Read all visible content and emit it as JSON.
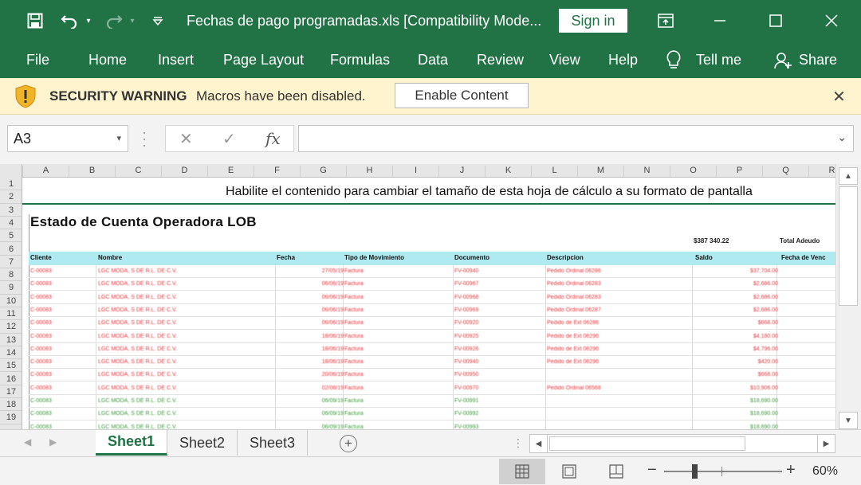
{
  "titlebar": {
    "title": "Fechas de pago programadas.xls  [Compatibility Mode...",
    "sign_in": "Sign in"
  },
  "ribbon": {
    "tabs": [
      "File",
      "Home",
      "Insert",
      "Page Layout",
      "Formulas",
      "Data",
      "Review",
      "View",
      "Help",
      "Tell me",
      "Share"
    ]
  },
  "security": {
    "warning": "SECURITY WARNING",
    "message": "Macros have been disabled.",
    "button": "Enable Content"
  },
  "formula_bar": {
    "name_box": "A3",
    "fx": "fx",
    "value": ""
  },
  "grid": {
    "columns": [
      "A",
      "B",
      "C",
      "D",
      "E",
      "F",
      "G",
      "H",
      "I",
      "J",
      "K",
      "L",
      "M",
      "N",
      "O",
      "P",
      "Q",
      "R"
    ],
    "rows": [
      "1",
      "2",
      "3",
      "4",
      "5",
      "6",
      "7",
      "8",
      "9",
      "10",
      "11",
      "12",
      "13",
      "14",
      "15",
      "16",
      "17",
      "18",
      "19"
    ]
  },
  "sheet": {
    "notice": "Habilite el contenido para cambiar el tamaño de esta hoja de cálculo a su formato de pantalla",
    "report_title": "Estado de Cuenta Operadora LOB",
    "saldo_top": "$387 340.22",
    "total_top": "Total Adeudo",
    "headers": [
      "Cliente",
      "Nombre",
      "Fecha",
      "Tipo de Movimiento",
      "Documento",
      "Descripcion",
      "Saldo",
      "Fecha de Venc"
    ],
    "rows": [
      {
        "cliente": "C-00083",
        "nombre": "LGC MODA, S DE R.L. DE C.V.",
        "fecha": "27/05/19",
        "tipo": "Factura",
        "doc": "FV-00940",
        "desc": "Pedido Ordinal 06286",
        "saldo": "$37,704.00",
        "color": "#e8343a"
      },
      {
        "cliente": "C-00083",
        "nombre": "LGC MODA, S DE R.L. DE C.V.",
        "fecha": "06/06/19",
        "tipo": "Factura",
        "doc": "FV-00967",
        "desc": "Pedido Ordinal 06283",
        "saldo": "$2,686.00",
        "color": "#e8343a"
      },
      {
        "cliente": "C-00083",
        "nombre": "LGC MODA, S DE R.L. DE C.V.",
        "fecha": "06/06/19",
        "tipo": "Factura",
        "doc": "FV-00968",
        "desc": "Pedido Ordinal 06283",
        "saldo": "$2,686.00",
        "color": "#e8343a"
      },
      {
        "cliente": "C-00083",
        "nombre": "LGC MODA, S DE R.L. DE C.V.",
        "fecha": "06/06/19",
        "tipo": "Factura",
        "doc": "FV-00969",
        "desc": "Pedido Ordinal 06287",
        "saldo": "$2,686.00",
        "color": "#e8343a"
      },
      {
        "cliente": "C-00083",
        "nombre": "LGC MODA, S DE R.L. DE C.V.",
        "fecha": "06/06/19",
        "tipo": "Factura",
        "doc": "FV-00920",
        "desc": "Pedido de Ext 06286",
        "saldo": "$668.00",
        "color": "#e8343a"
      },
      {
        "cliente": "C-00083",
        "nombre": "LGC MODA, S DE R.L. DE C.V.",
        "fecha": "18/06/19",
        "tipo": "Factura",
        "doc": "FV-00925",
        "desc": "Pedido de Ext 06296",
        "saldo": "$4,180.00",
        "color": "#e8343a"
      },
      {
        "cliente": "C-00083",
        "nombre": "LGC MODA, S DE R.L. DE C.V.",
        "fecha": "18/06/19",
        "tipo": "Factura",
        "doc": "FV-00926",
        "desc": "Pedido de Ext 06296",
        "saldo": "$4,796.00",
        "color": "#e8343a"
      },
      {
        "cliente": "C-00083",
        "nombre": "LGC MODA, S DE R.L. DE C.V.",
        "fecha": "18/06/19",
        "tipo": "Factura",
        "doc": "FV-00940",
        "desc": "Pedido de Ext 06296",
        "saldo": "$420.00",
        "color": "#e8343a"
      },
      {
        "cliente": "C-00083",
        "nombre": "LGC MODA, S DE R.L. DE C.V.",
        "fecha": "20/06/19",
        "tipo": "Factura",
        "doc": "FV-00950",
        "desc": "",
        "saldo": "$668.00",
        "color": "#e8343a"
      },
      {
        "cliente": "C-00083",
        "nombre": "LGC MODA, S DE R.L. DE C.V.",
        "fecha": "02/08/19",
        "tipo": "Factura",
        "doc": "FV-00970",
        "desc": "Pedido Ordinal 06568",
        "saldo": "$10,906.00",
        "color": "#e8343a"
      },
      {
        "cliente": "C-00083",
        "nombre": "LGC MODA, S DE R.L. DE C.V.",
        "fecha": "06/09/19",
        "tipo": "Factura",
        "doc": "FV-00991",
        "desc": "",
        "saldo": "$18,690.00",
        "color": "#3a9a3a"
      },
      {
        "cliente": "C-00083",
        "nombre": "LGC MODA, S DE R.L. DE C.V.",
        "fecha": "06/09/19",
        "tipo": "Factura",
        "doc": "FV-00992",
        "desc": "",
        "saldo": "$18,690.00",
        "color": "#3a9a3a"
      },
      {
        "cliente": "C-00083",
        "nombre": "LGC MODA, S DE R.L. DE C.V.",
        "fecha": "06/09/19",
        "tipo": "Factura",
        "doc": "FV-00993",
        "desc": "",
        "saldo": "$18,690.00",
        "color": "#3a9a3a"
      }
    ]
  },
  "sheet_tabs": [
    "Sheet1",
    "Sheet2",
    "Sheet3"
  ],
  "status": {
    "zoom": "60%",
    "zoom_fraction": 0.26
  }
}
